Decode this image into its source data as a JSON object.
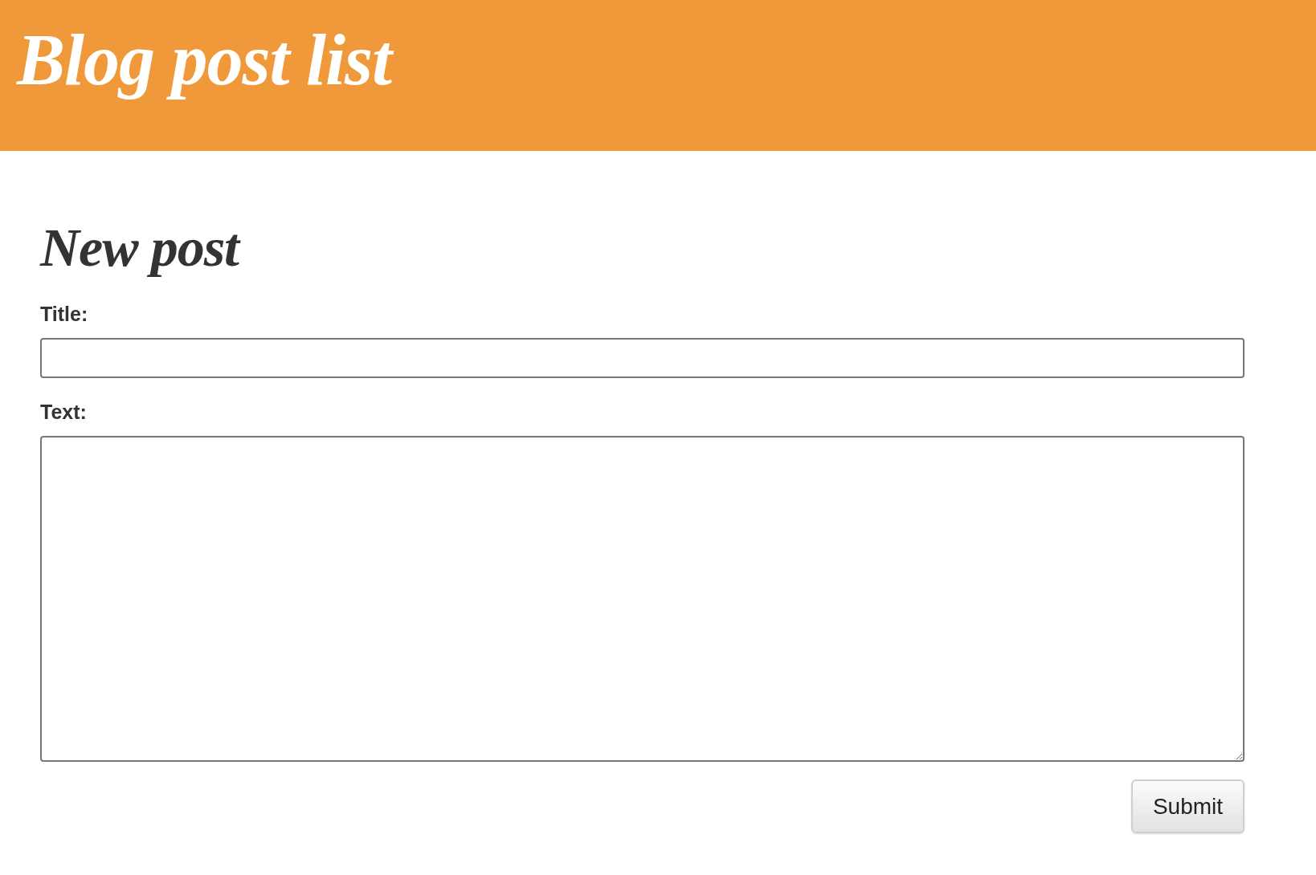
{
  "header": {
    "title": "Blog post list"
  },
  "form": {
    "heading": "New post",
    "fields": [
      {
        "kind": "input",
        "label": "Title:"
      },
      {
        "kind": "textarea",
        "label": "Text:"
      }
    ],
    "submit": {
      "label": "Submit"
    }
  }
}
